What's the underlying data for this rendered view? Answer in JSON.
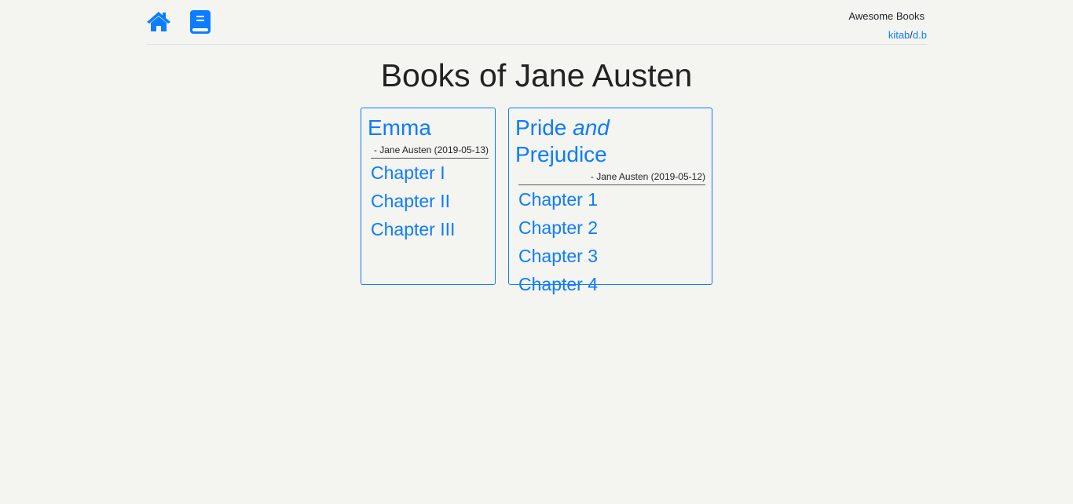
{
  "header": {
    "brand": "Awesome Books",
    "link1": "kitab",
    "sep": "/",
    "link2": "d.b",
    "icons": [
      "home-icon",
      "book-icon"
    ]
  },
  "page_title": "Books of Jane Austen",
  "books": [
    {
      "title": "Emma",
      "byline": "- Jane Austen (2019-05-13)",
      "chapters": [
        "Chapter I",
        "Chapter II",
        "Chapter III"
      ]
    },
    {
      "title_pre": "Pride ",
      "title_em": "and",
      "title_post": " Prejudice",
      "byline": "- Jane Austen (2019-05-12)",
      "chapters": [
        "Chapter 1",
        "Chapter 2",
        "Chapter 3",
        "Chapter 4"
      ]
    }
  ]
}
